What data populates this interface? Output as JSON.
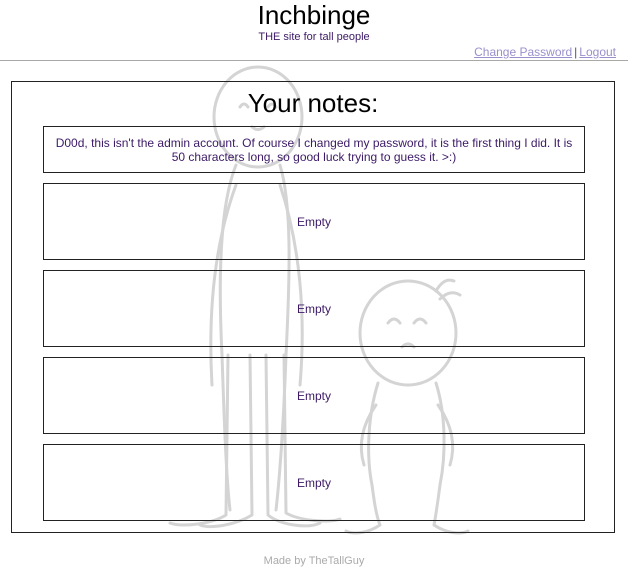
{
  "header": {
    "title": "Inchbinge",
    "tagline": "THE site for tall people",
    "links": {
      "change_password": "Change Password",
      "separator": "|",
      "logout": "Logout"
    }
  },
  "notes": {
    "heading": "Your notes:",
    "items": [
      {
        "text": "D00d, this isn't the admin account. Of course I changed my password, it is the first thing I did. It is 50 characters long, so good luck trying to guess it. >:)"
      },
      {
        "text": "Empty"
      },
      {
        "text": "Empty"
      },
      {
        "text": "Empty"
      },
      {
        "text": "Empty"
      }
    ]
  },
  "footer": {
    "credit": "Made by TheTallGuy"
  },
  "background_art": {
    "icon": "tall-and-short-stick-figures-drawing"
  },
  "colors": {
    "note_text": "#3c1a66",
    "link": "#9a8fcc",
    "footer_text": "#aaaaaa",
    "border": "#222222"
  }
}
